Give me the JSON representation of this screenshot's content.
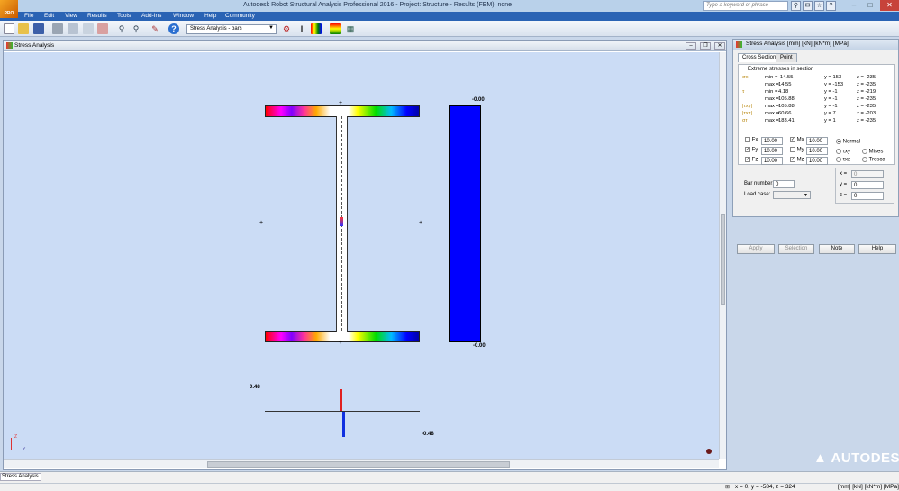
{
  "app": {
    "title": "Autodesk Robot Structural Analysis Professional 2016 - Project: Structure - Results (FEM): none",
    "logo_text": "PRO",
    "search_placeholder": "Type a keyword or phrase"
  },
  "menu": [
    "File",
    "Edit",
    "View",
    "Results",
    "Tools",
    "Add-Ins",
    "Window",
    "Help",
    "Community"
  ],
  "toolbar": {
    "stress_dropdown": "Stress Analysis - bars"
  },
  "main_window": {
    "title": "Stress Analysis"
  },
  "canvas": {
    "top_right_label": "-0.00",
    "bottom_right_label": "-0.00",
    "diag_top": "0.48",
    "diag_bottom": "-0.48",
    "axis_z": "Z",
    "axis_y": "Y"
  },
  "panel": {
    "title": "Stress Analysis   [mm] [kN] [kN*m] [MPa]",
    "tabs": [
      "Cross Section",
      "Point"
    ],
    "group_title": "Extreme stresses in section",
    "rows": [
      {
        "sym": "σx",
        "label": "min =",
        "value": "-14.55",
        "y": "y = 153",
        "z": "z = -235"
      },
      {
        "sym": "",
        "label": "max =",
        "value": "14.55",
        "y": "y = -153",
        "z": "z = -235"
      },
      {
        "sym": "τ",
        "label": "min =",
        "value": "4.18",
        "y": "y = -1",
        "z": "z = -219"
      },
      {
        "sym": "",
        "label": "max =",
        "value": "105.88",
        "y": "y = -1",
        "z": "z = -235"
      },
      {
        "sym": "|τxy|",
        "label": "max =",
        "value": "105.88",
        "y": "y = -1",
        "z": "z = -235"
      },
      {
        "sym": "|τxz|",
        "label": "max =",
        "value": "60.66",
        "y": "y = 7",
        "z": "z = -203"
      },
      {
        "sym": "σr",
        "label": "max =",
        "value": "183.41",
        "y": "y = 1",
        "z": "z = -235"
      }
    ],
    "forces": [
      {
        "name": "Fx",
        "value": "10.00",
        "checked": false
      },
      {
        "name": "Fy",
        "value": "10.00",
        "checked": true
      },
      {
        "name": "Fz",
        "value": "10.00",
        "checked": true
      }
    ],
    "moments": [
      {
        "name": "Mx",
        "value": "10.00",
        "checked": true
      },
      {
        "name": "My",
        "value": "10.00",
        "checked": false
      },
      {
        "name": "Mz",
        "value": "10.00",
        "checked": true
      }
    ],
    "radio": {
      "normal": "Normal",
      "txy": "τxy",
      "txz": "τxz",
      "mises": "Mises",
      "tresca": "Tresca"
    },
    "point": {
      "x_label": "x =",
      "x": "0",
      "y_label": "y =",
      "y": "0",
      "z_label": "z =",
      "z": "0"
    },
    "bar_number_label": "Bar number:",
    "bar_number": "0",
    "load_case_label": "Load case:",
    "buttons": {
      "apply": "Apply",
      "selection": "Selection",
      "note": "Note",
      "help": "Help"
    }
  },
  "autodesk_logo": "AUTODESK.",
  "status": {
    "tab": "Stress Analysis",
    "coords": "x = 0,  y = -584,  z = 324",
    "units": "[mm] [kN] [kN*m] [MPa]"
  }
}
